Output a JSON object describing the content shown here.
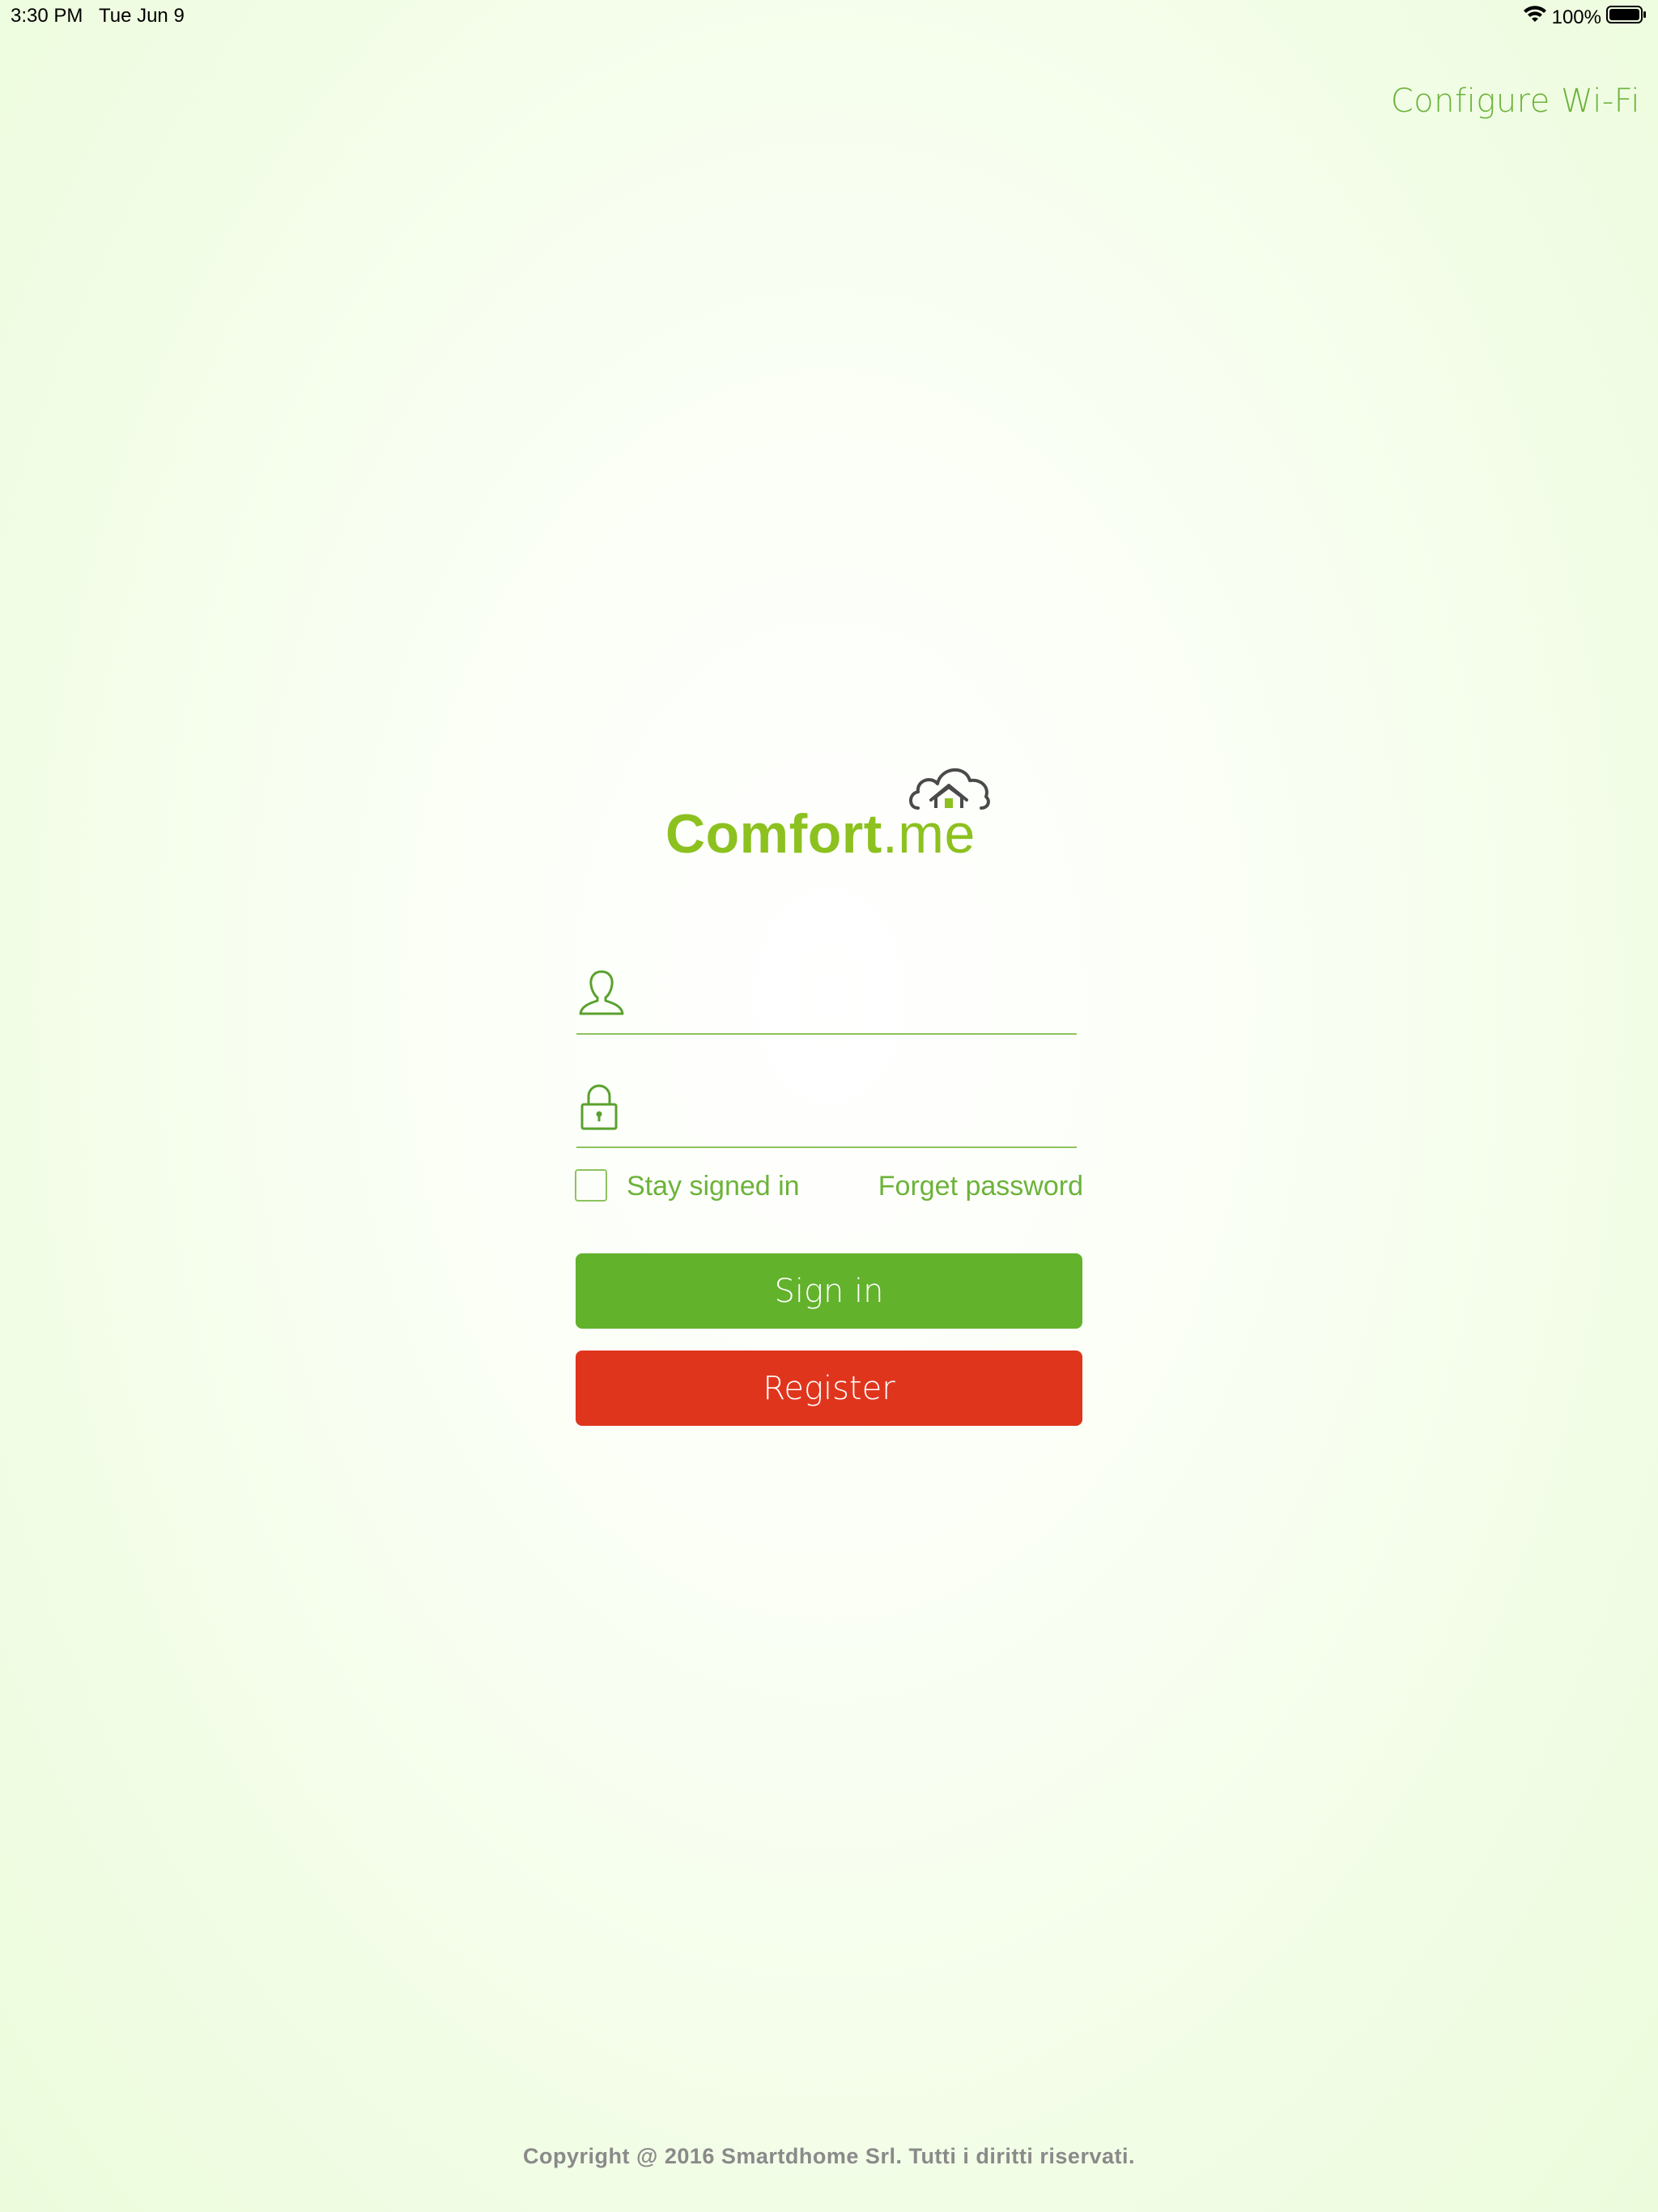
{
  "status_bar": {
    "time": "3:30 PM   Tue Jun 9",
    "battery": "100%",
    "wifi_icon": "wifi-icon",
    "battery_icon": "battery-icon"
  },
  "header": {
    "configure_wifi": "Configure Wi-Fi"
  },
  "logo": {
    "text_main": "Comfort",
    "text_suffix": ".me",
    "icon": "cloud-house-icon"
  },
  "form": {
    "username": {
      "value": "",
      "placeholder": "",
      "icon": "user-icon"
    },
    "password": {
      "value": "",
      "placeholder": "",
      "icon": "lock-icon"
    },
    "stay_signed_in": "Stay signed in",
    "stay_signed_in_checked": false,
    "forget_password": "Forget password",
    "sign_in": "Sign in",
    "register": "Register"
  },
  "footer": {
    "copyright": "Copyright @ 2016 Smartdhome Srl. Tutti i diritti riservati."
  },
  "colors": {
    "accent_green": "#6cb33a",
    "sign_in_button": "#62b22c",
    "register_button": "#e0351d",
    "logo_green": "#8cc11f"
  }
}
